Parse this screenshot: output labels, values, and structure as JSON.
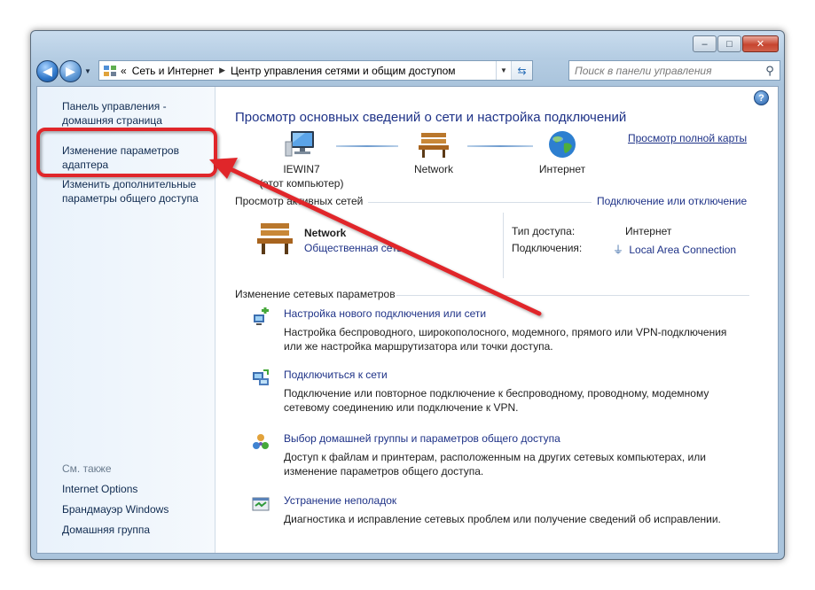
{
  "window": {
    "minimize_glyph": "–",
    "maximize_glyph": "□",
    "close_glyph": "✕"
  },
  "navbar": {
    "back_glyph": "◀",
    "forward_glyph": "▶",
    "dropdown_glyph": "▼",
    "address_prefix": "«",
    "breadcrumb": [
      "Сеть и Интернет",
      "Центр управления сетями и общим доступом"
    ],
    "breadcrumb_sep": "▶",
    "refresh_glyph": "⇆",
    "search_placeholder": "Поиск в панели управления",
    "search_glyph": "⚲"
  },
  "sidebar": {
    "home_link": [
      "Панель управления -",
      "домашняя страница"
    ],
    "adapter_link": [
      "Изменение параметров",
      "адаптера"
    ],
    "sharing_link": [
      "Изменить дополнительные",
      "параметры общего доступа"
    ],
    "see_also_caption": "См. также",
    "see_also": [
      "Internet Options",
      "Брандмауэр Windows",
      "Домашняя группа"
    ]
  },
  "main": {
    "help_glyph": "?",
    "title": "Просмотр основных сведений о сети и настройка подключений",
    "full_map_link": "Просмотр полной карты",
    "map": {
      "computer_name": "IEWIN7",
      "computer_sub": "(этот компьютер)",
      "network_label": "Network",
      "internet_label": "Интернет"
    },
    "active_networks": {
      "heading": "Просмотр активных сетей",
      "connect_link": "Подключение или отключение",
      "network_name": "Network",
      "network_type": "Общественная сеть",
      "access_type_label": "Тип доступа:",
      "access_type_value": "Интернет",
      "connections_label": "Подключения:",
      "connections_value": "Local Area Connection"
    },
    "change_settings": {
      "heading": "Изменение сетевых параметров",
      "tasks": [
        {
          "link": "Настройка нового подключения или сети",
          "desc1": "Настройка беспроводного, широкополосного, модемного, прямого или VPN-подключения",
          "desc2": "или же настройка маршрутизатора или точки доступа."
        },
        {
          "link": "Подключиться к сети",
          "desc1": "Подключение или повторное подключение к беспроводному, проводному, модемному",
          "desc2": "сетевому соединению или подключение к VPN."
        },
        {
          "link": "Выбор домашней группы и параметров общего доступа",
          "desc1": "Доступ к файлам и принтерам, расположенным на других сетевых компьютерах, или",
          "desc2": "изменение параметров общего доступа."
        },
        {
          "link": "Устранение неполадок",
          "desc1": "Диагностика и исправление сетевых проблем или получение сведений об исправлении.",
          "desc2": ""
        }
      ]
    }
  },
  "colors": {
    "link": "#1e3287",
    "highlight_box": "#e0262b",
    "arrow": "#e0262b"
  }
}
